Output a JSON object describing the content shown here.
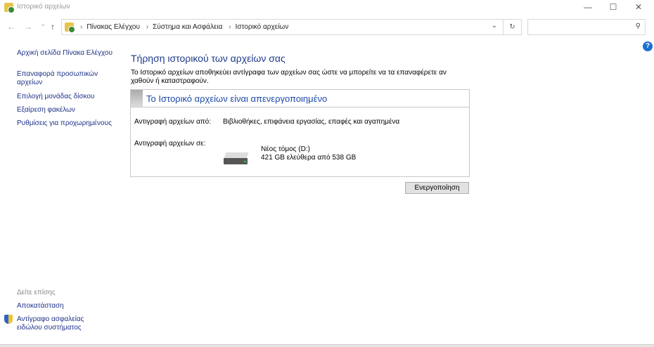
{
  "window": {
    "title": "Ιστορικό αρχείων",
    "minimize": "—",
    "maximize": "☐",
    "close": "✕"
  },
  "nav": {
    "back": "←",
    "forward": "→",
    "recent": "⌄",
    "up": "↑",
    "breadcrumbs": [
      "Πίνακας Ελέγχου",
      "Σύστημα και Ασφάλεια",
      "Ιστορικό αρχείων"
    ],
    "dropdown": "⌄",
    "refresh": "↻",
    "search_placeholder": "",
    "search_icon": "⚲"
  },
  "help": "?",
  "sidebar": {
    "items": [
      "Αρχική σελίδα Πίνακα Ελέγχου",
      "Επαναφορά προσωπικών αρχείων",
      "Επιλογή μονάδας δίσκου",
      "Εξαίρεση φακέλων",
      "Ρυθμίσεις για προχωρημένους"
    ],
    "see_also": "Δείτε επίσης",
    "see_also_items": [
      "Αποκατάσταση",
      "Αντίγραφο ασφαλείας ειδώλου συστήματος"
    ]
  },
  "main": {
    "title": "Τήρηση ιστορικού των αρχείων σας",
    "description": "Το Ιστορικό αρχείων αποθηκεύει αντίγραφα των αρχείων σας ώστε να μπορείτε να τα επαναφέρετε αν χαθούν ή καταστραφούν.",
    "status": "Το Ιστορικό αρχείων είναι απενεργοποιημένο",
    "copy_from_label": "Αντιγραφή αρχείων από:",
    "copy_from_value": "Βιβλιοθήκες, επιφάνεια εργασίας, επαφές και αγαπημένα",
    "copy_to_label": "Αντιγραφή αρχείων σε:",
    "drive_name": "Νέος τόμος (D:)",
    "drive_space": "421 GB ελεύθερα από 538 GB",
    "enable_button": "Ενεργοποίηση"
  }
}
